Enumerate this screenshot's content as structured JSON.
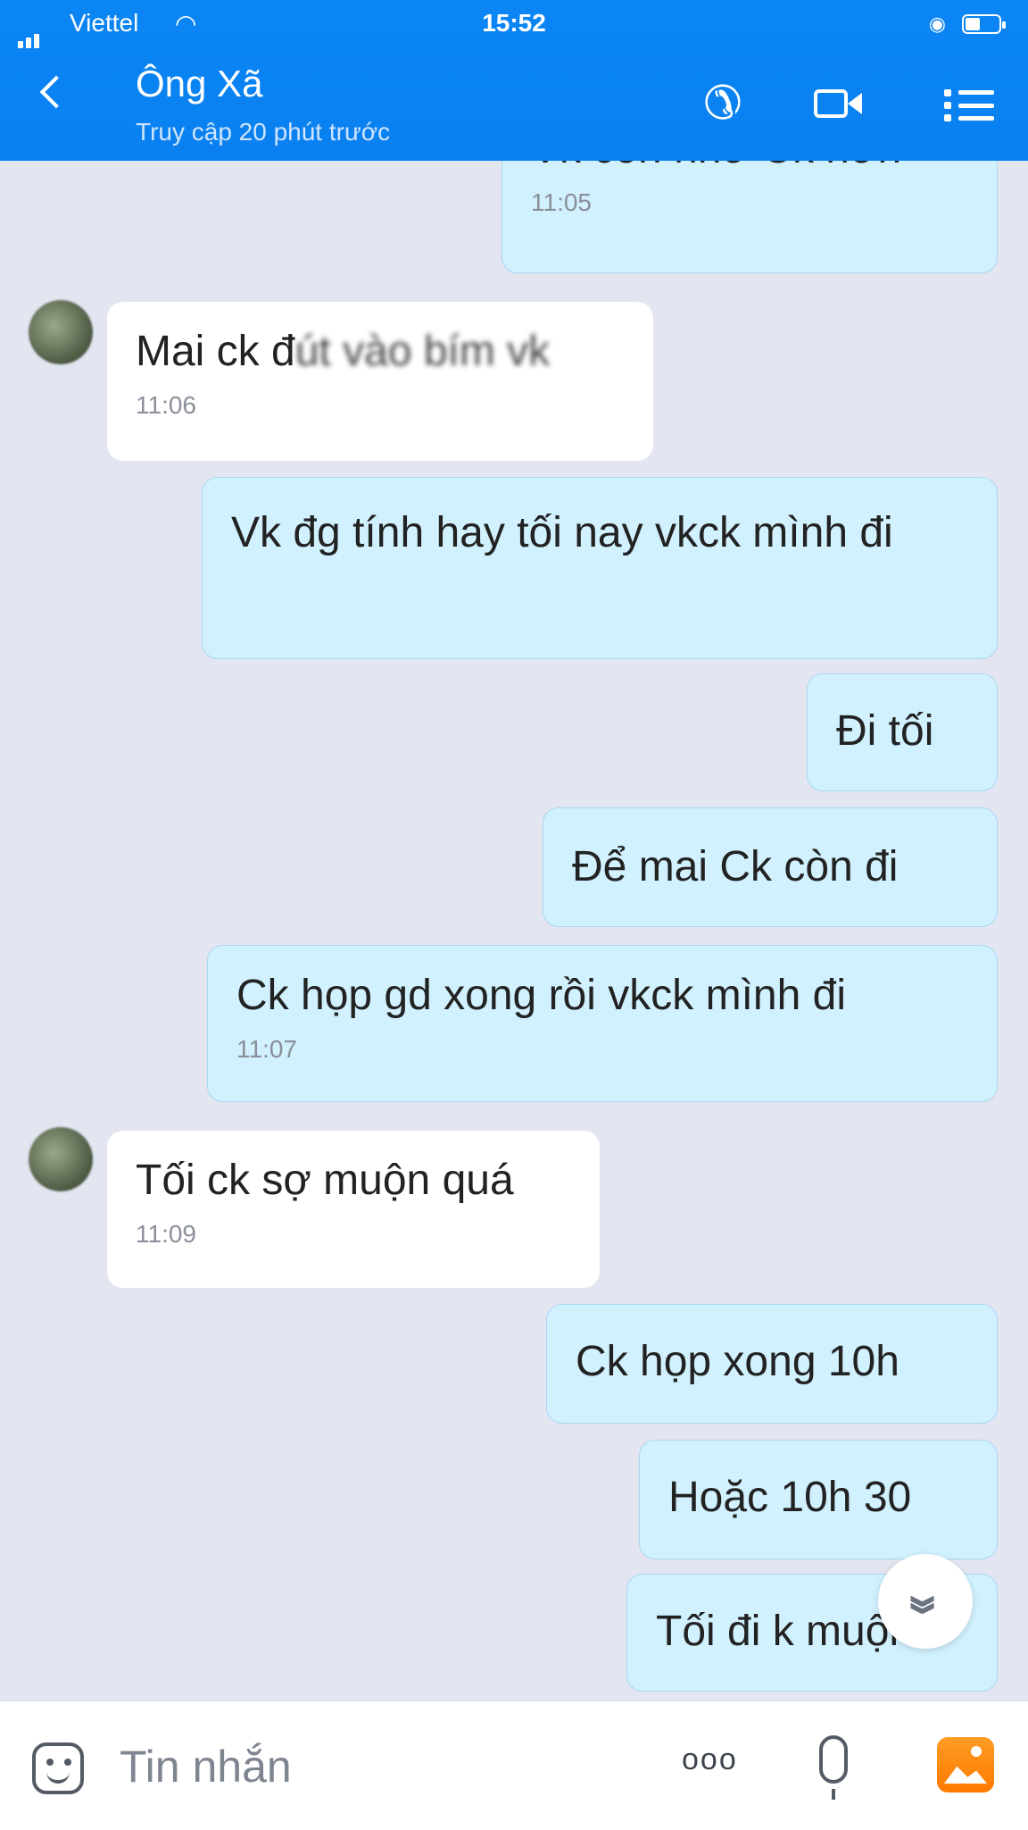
{
  "status_bar": {
    "carrier": "Viettel",
    "time": "15:52"
  },
  "header": {
    "contact_name": "Ông Xã",
    "contact_status": "Truy cập 20 phút trước",
    "icons": [
      "back-icon",
      "phone-icon",
      "video-call-icon",
      "menu-icon"
    ]
  },
  "messages": [
    {
      "side": "sent",
      "text": "Vk còn nhớ Ck hơn",
      "time": "11:05"
    },
    {
      "side": "received",
      "text_visible": "Mai ck đ",
      "text_blurred": "út vào bím vk",
      "time": "11:06"
    },
    {
      "side": "sent",
      "text": "Vk đg tính hay tối nay vkck mình đi",
      "time": ""
    },
    {
      "side": "sent",
      "text": "Đi tối",
      "time": ""
    },
    {
      "side": "sent",
      "text": "Để mai Ck còn đi",
      "time": ""
    },
    {
      "side": "sent",
      "text": "Ck họp gd xong rồi vkck mình đi",
      "time": "11:07"
    },
    {
      "side": "received",
      "text": "Tối ck sợ muộn quá",
      "time": "11:09"
    },
    {
      "side": "sent",
      "text": "Ck họp xong 10h",
      "time": ""
    },
    {
      "side": "sent",
      "text": "Hoặc 10h 30",
      "time": ""
    },
    {
      "side": "sent",
      "text": "Tối đi k muộn",
      "time": ""
    }
  ],
  "scroll_button_icon": "double-chevron-down-icon",
  "input_bar": {
    "placeholder": "Tin nhắn",
    "more_label": "ooo",
    "icons": [
      "sticker-icon",
      "more-icon",
      "microphone-icon",
      "gallery-icon"
    ]
  },
  "colors": {
    "header_blue": "#0a84f2",
    "sent_bubble": "#d1f1fe",
    "received_bubble": "#ffffff",
    "chat_background": "#e3e5f1",
    "gallery_orange": "#ff8a12"
  }
}
